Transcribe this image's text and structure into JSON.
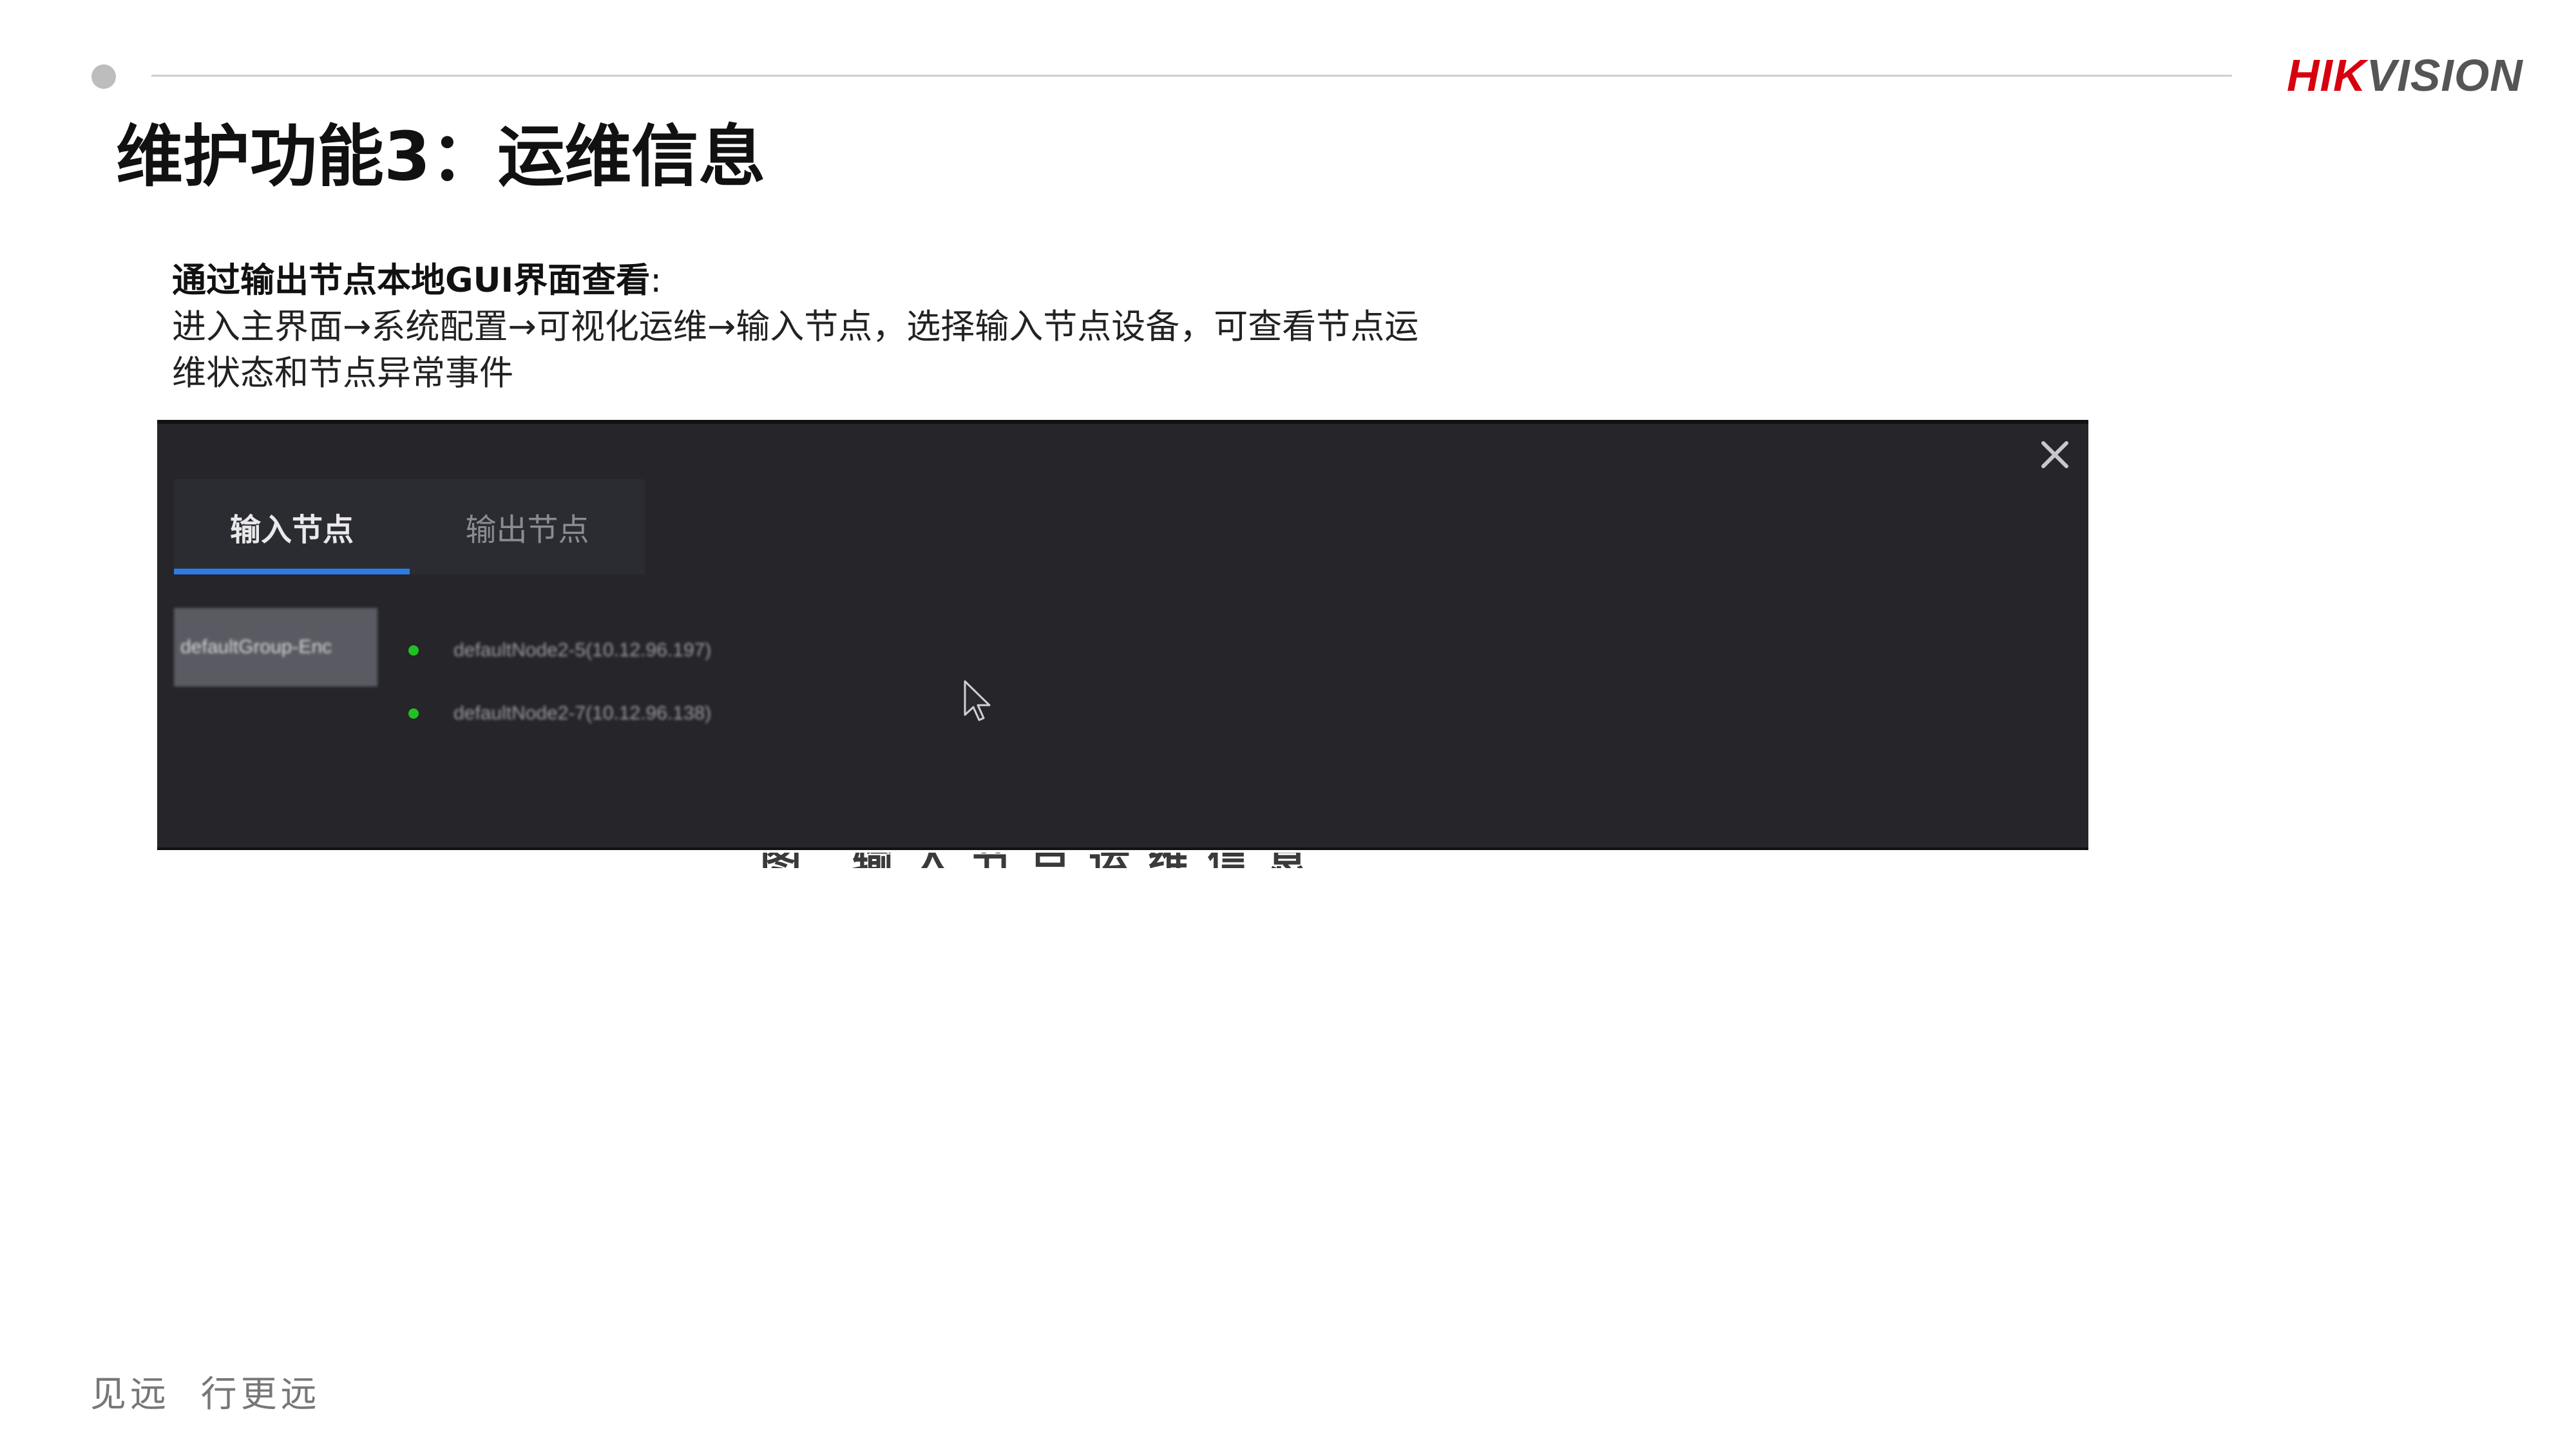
{
  "brand": {
    "logo_part1": "HIK",
    "logo_part2": "VISION"
  },
  "page_title": "维护功能3：运维信息",
  "instructions": {
    "heading": "通过输出节点本地GUI界面查看",
    "heading_colon": ":",
    "line1": "进入主界面→系统配置→可视化运维→输入节点，选择输入节点设备，可查看节点运",
    "line2": "维状态和节点异常事件"
  },
  "screenshot": {
    "close_icon": "close-icon",
    "tabs": [
      {
        "label": "输入节点",
        "active": true
      },
      {
        "label": "输出节点",
        "active": false
      }
    ],
    "group": {
      "label": "defaultGroup-Enc"
    },
    "nodes": [
      {
        "label": "defaultNode2-5(10.12.96.197)",
        "status_color": "#22c022"
      },
      {
        "label": "defaultNode2-7(10.12.96.138)",
        "status_color": "#22c022"
      }
    ],
    "cursor_icon": "mouse-pointer-icon"
  },
  "caption_partial": "图 输入节点运维信息",
  "colors": {
    "accent_tab": "#2d7be5",
    "brand_red": "#d7000f",
    "panel_bg": "#25252a"
  },
  "slogan": "见远  行更远"
}
